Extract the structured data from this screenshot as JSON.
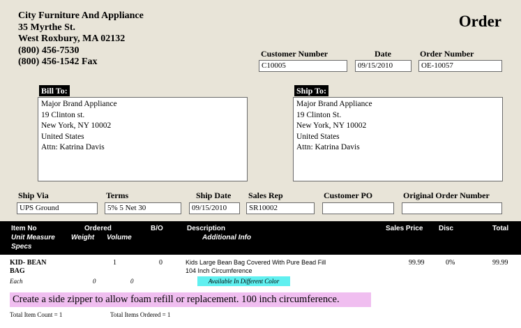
{
  "company": {
    "name": "City Furniture And Appliance",
    "street": "35 Myrthe St.",
    "city": "West Roxbury,  MA  02132",
    "phone": "(800) 456-7530",
    "fax": "(800) 456-1542 Fax"
  },
  "doc_title": "Order",
  "header_fields": {
    "customer_number_label": "Customer Number",
    "customer_number": "C10005",
    "date_label": "Date",
    "date": "09/15/2010",
    "order_number_label": "Order Number",
    "order_number": "OE-10057"
  },
  "bill_to": {
    "label": "Bill To:",
    "lines": [
      "Major Brand Appliance",
      "19 Clinton st.",
      "New York,  NY  10002",
      "United States",
      "Attn: Katrina Davis"
    ]
  },
  "ship_to": {
    "label": "Ship To:",
    "lines": [
      "Major Brand Appliance",
      "19 Clinton St.",
      "New York,  NY  10002",
      "United States",
      "Attn: Katrina Davis"
    ]
  },
  "order_fields": {
    "ship_via_label": "Ship Via",
    "ship_via": "UPS Ground",
    "terms_label": "Terms",
    "terms": "5% 5 Net 30",
    "ship_date_label": "Ship Date",
    "ship_date": "09/15/2010",
    "sales_rep_label": "Sales Rep",
    "sales_rep": "SR10002",
    "customer_po_label": "Customer PO",
    "customer_po": "",
    "original_order_label": "Original Order Number",
    "original_order": ""
  },
  "grid_headers": {
    "item_no": "Item No",
    "ordered": "Ordered",
    "bo": "B/O",
    "description": "Description",
    "sales_price": "Sales Price",
    "disc": "Disc",
    "total": "Total",
    "unit_measure": "Unit Measure",
    "weight": "Weight",
    "volume": "Volume",
    "additional_info": "Additional Info",
    "specs": "Specs"
  },
  "line_item": {
    "item_no_1": "KID- BEAN",
    "item_no_2": "BAG",
    "ordered": "1",
    "bo": "0",
    "description_1": "Kids Large Bean Bag Covered With Pure Bead Fill",
    "description_2": "104 Inch Circumference",
    "sales_price": "99.99",
    "disc": "0%",
    "total": "99.99",
    "unit": "Each",
    "weight": "0",
    "volume": "0",
    "additional_info": "Available In Different Color",
    "note": "Create a side zipper to allow foam refill or replacement. 100 inch circumference."
  },
  "totals": {
    "item_count": "Total Item Count = 1",
    "items_ordered": "Total Items Ordered = 1"
  }
}
